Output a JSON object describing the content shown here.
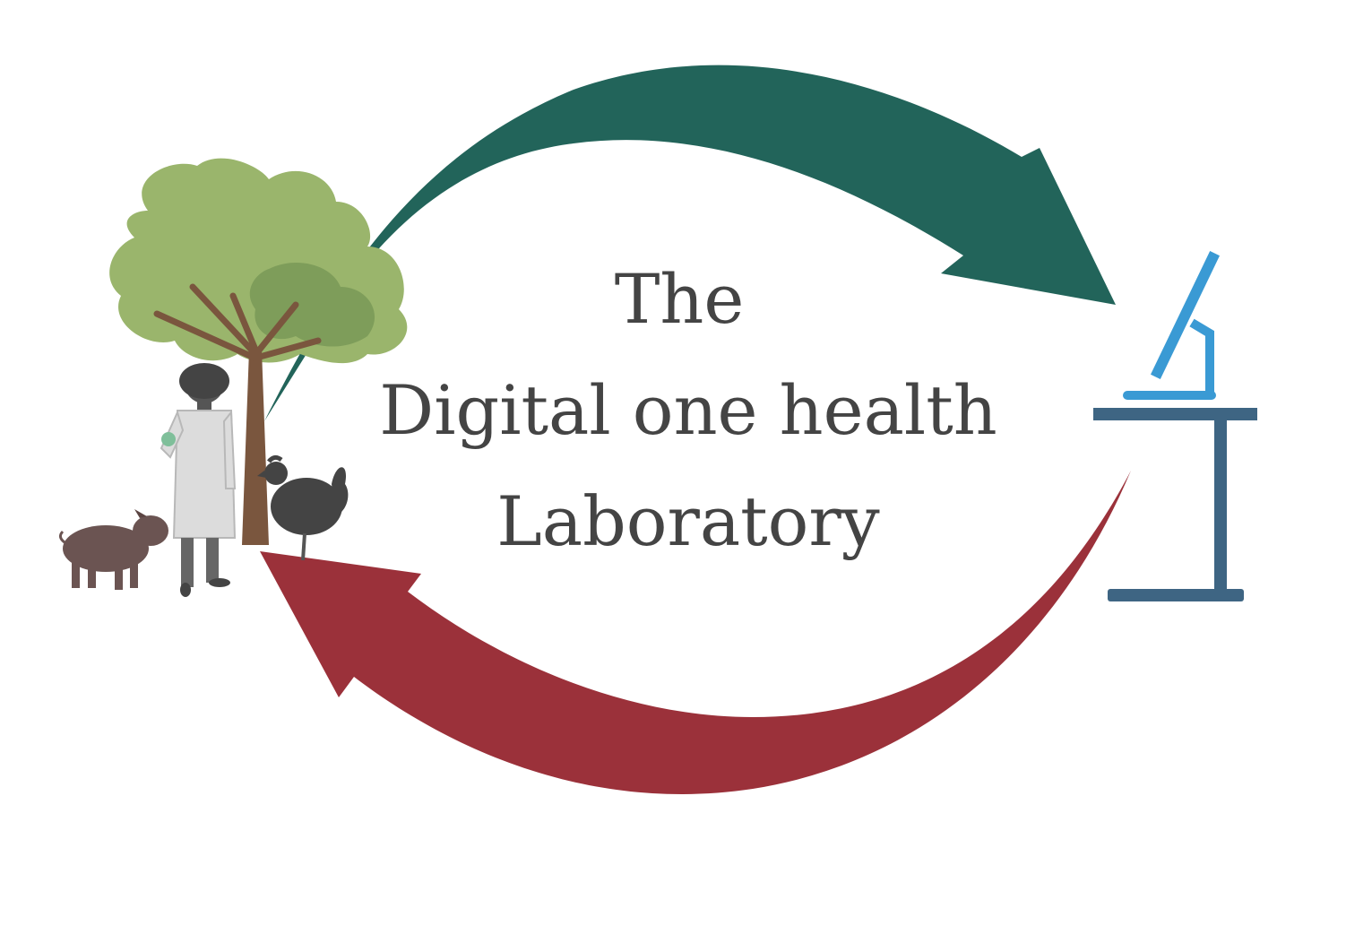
{
  "title": {
    "line1": "The",
    "line2": "Digital one health",
    "line3": "Laboratory"
  },
  "colors": {
    "background": "#ffffff",
    "top_arrow": "#22645a",
    "bottom_arrow": "#9b313a",
    "text": "#444444",
    "tree_foliage": "#9ab56c",
    "tree_foliage_dark": "#7e9d5a",
    "tree_trunk": "#7a563e",
    "lab_coat": "#dcdcdc",
    "person_skin": "#555555",
    "pig": "#6b5452",
    "chicken": "#444444",
    "monitor": "#3a9ad4",
    "desk": "#3e6583"
  },
  "icons": {
    "left_scene": "field-scene-tree-scientist-pig-chicken",
    "right_scene": "computer-workstation-icon"
  }
}
